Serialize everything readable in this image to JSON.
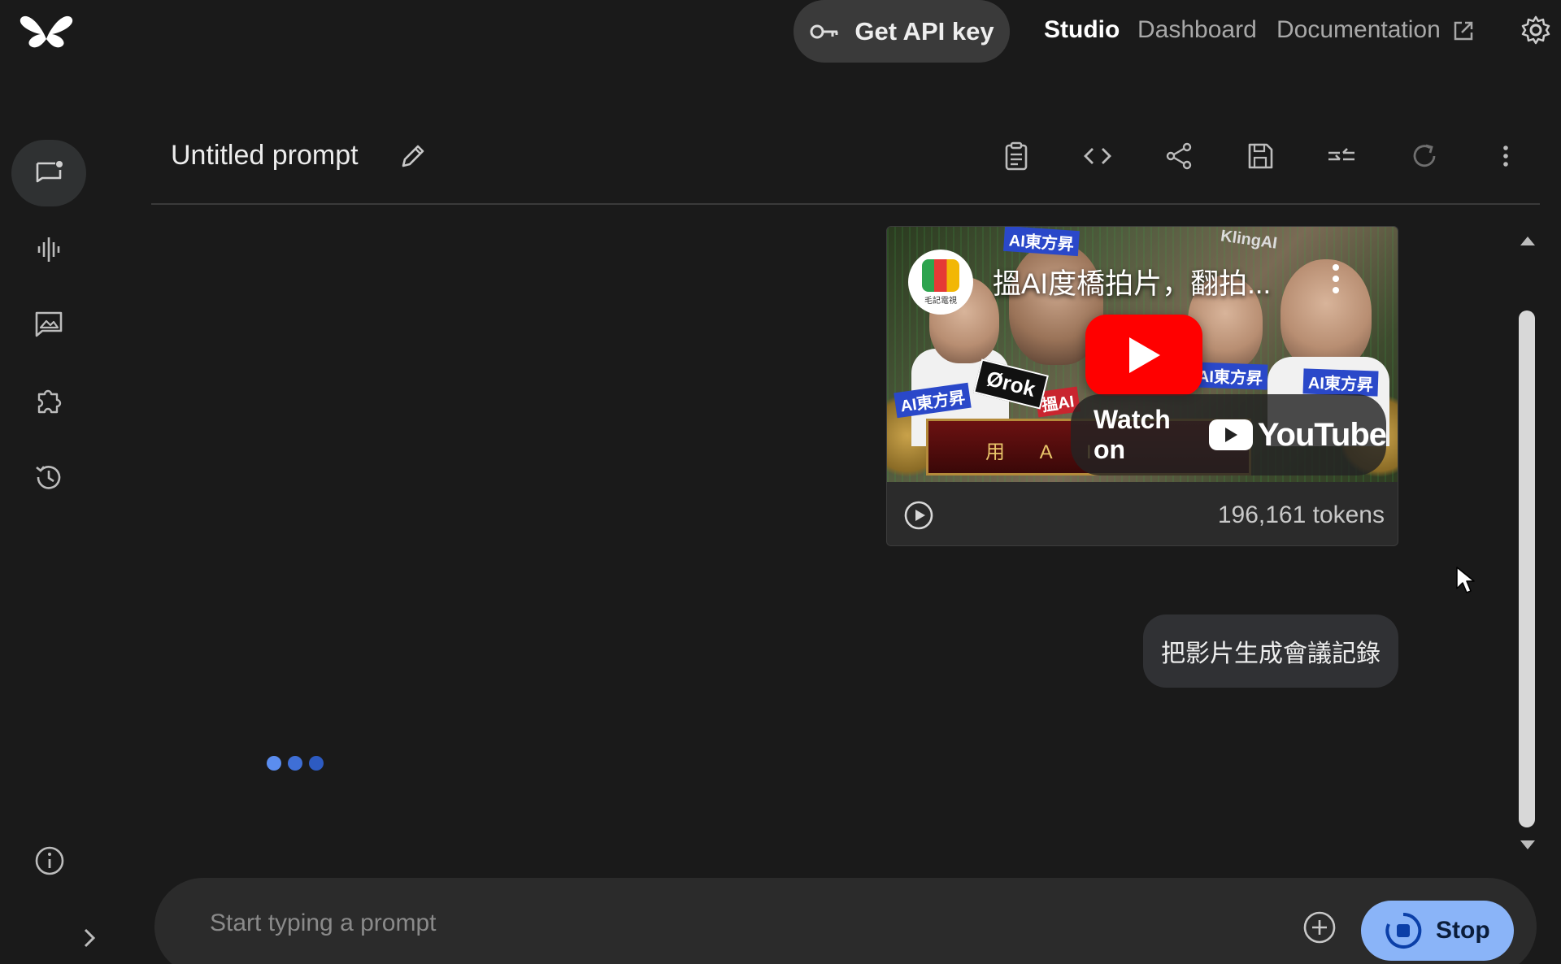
{
  "topbar": {
    "api_key_label": "Get API key",
    "nav": {
      "studio": "Studio",
      "dashboard": "Dashboard",
      "documentation": "Documentation"
    }
  },
  "sidebar": {
    "items": [
      {
        "name": "chat",
        "icon": "chat-prompt-icon",
        "active": true
      },
      {
        "name": "stream",
        "icon": "audio-wave-icon",
        "active": false
      },
      {
        "name": "generate-media",
        "icon": "image-chat-icon",
        "active": false
      },
      {
        "name": "build",
        "icon": "puzzle-icon",
        "active": false
      },
      {
        "name": "history",
        "icon": "history-icon",
        "active": false
      }
    ]
  },
  "header": {
    "prompt_title": "Untitled prompt"
  },
  "video": {
    "title": "搵AI度橋拍片，翻拍...",
    "channel_label": "毛記電視",
    "watch_on": "Watch on",
    "youtube_word": "YouTube",
    "tokens": "196,161 tokens",
    "thumbnail_texts": [
      "AI東方昇",
      "AI東方昇",
      "AI東方昇",
      "AI東方昇",
      "搵AI",
      "KlingAI",
      "用 A I"
    ],
    "grok_label": "Ørok"
  },
  "user_message": {
    "text": "把影片生成會議記錄"
  },
  "loading_dots": {
    "colors": [
      "#5b8def",
      "#3f6fd6",
      "#2d5bc2"
    ]
  },
  "prompt": {
    "placeholder": "Start typing a prompt",
    "stop_label": "Stop"
  },
  "colors": {
    "background": "#1a1a1a",
    "accent": "#8ab4f8",
    "youtube_red": "#ff0000"
  }
}
